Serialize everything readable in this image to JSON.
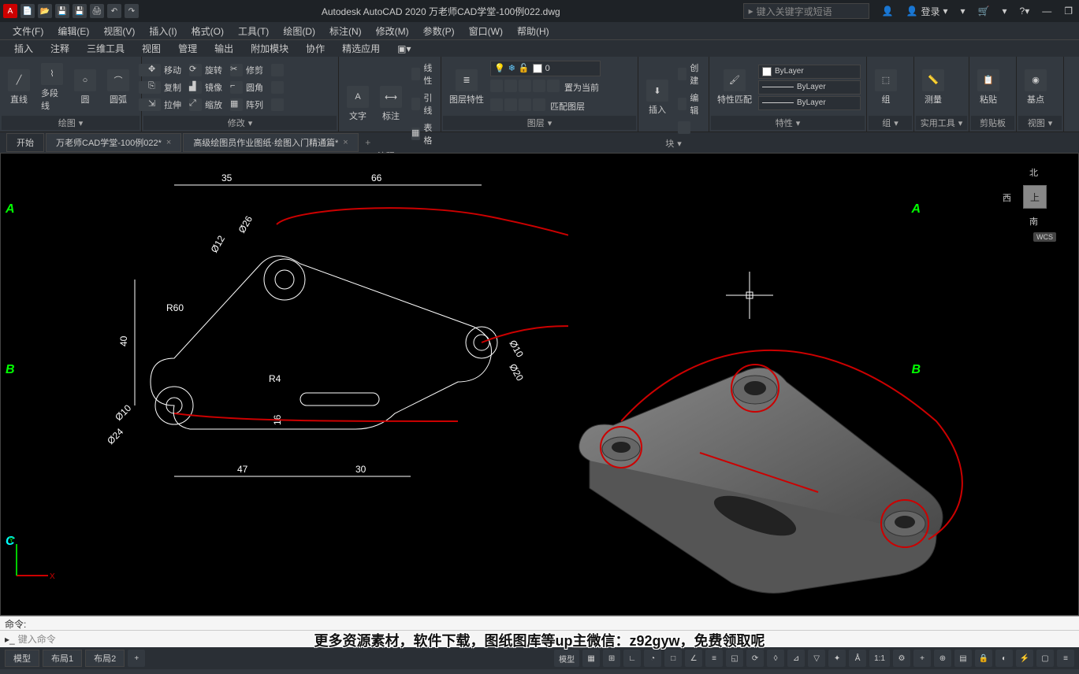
{
  "app": {
    "title": "Autodesk AutoCAD 2020   万老师CAD学堂-100例022.dwg",
    "search_placeholder": "键入关键字或短语",
    "login": "登录"
  },
  "menubar": [
    "文件(F)",
    "编辑(E)",
    "视图(V)",
    "插入(I)",
    "格式(O)",
    "工具(T)",
    "绘图(D)",
    "标注(N)",
    "修改(M)",
    "参数(P)",
    "窗口(W)",
    "帮助(H)"
  ],
  "ribbon_tabs": [
    "插入",
    "注释",
    "三维工具",
    "视图",
    "管理",
    "输出",
    "附加模块",
    "协作",
    "精选应用"
  ],
  "ribbon": {
    "draw": {
      "title": "绘图",
      "line": "直线",
      "polyline": "多段线",
      "circle": "圆",
      "arc": "圆弧"
    },
    "modify": {
      "title": "修改",
      "items": [
        "移动",
        "旋转",
        "修剪",
        "复制",
        "镜像",
        "圆角",
        "拉伸",
        "缩放",
        "阵列"
      ]
    },
    "annot": {
      "title": "注释",
      "text": "文字",
      "dim": "标注",
      "linear": "线性",
      "leader": "引线",
      "table": "表格"
    },
    "layer": {
      "title": "图层",
      "props": "图层特性",
      "current": "0",
      "set_current": "置为当前",
      "match": "匹配图层"
    },
    "block": {
      "title": "块",
      "insert": "插入",
      "create": "创建",
      "edit": "编辑"
    },
    "props": {
      "title": "特性",
      "match": "特性匹配",
      "bylayer": "ByLayer"
    },
    "group": {
      "title": "组",
      "label": "组"
    },
    "util": {
      "title": "实用工具",
      "measure": "测量"
    },
    "clip": {
      "title": "剪贴板",
      "paste": "粘贴"
    },
    "view": {
      "title": "视图",
      "base": "基点"
    }
  },
  "file_tabs": {
    "start": "开始",
    "tabs": [
      "万老师CAD学堂-100例022*",
      "高级绘图员作业图纸·绘图入门精通篇*"
    ]
  },
  "drawing": {
    "dims": {
      "d35": "35",
      "d66": "66",
      "d40": "40",
      "d47": "47",
      "d30": "30",
      "d16": "16",
      "r60": "R60",
      "r4": "R4",
      "dia26": "Ø26",
      "dia12": "Ø12",
      "dia10a": "Ø10",
      "dia20": "Ø20",
      "dia10b": "Ø10",
      "dia24": "Ø24"
    },
    "labels": {
      "A": "A",
      "B": "B",
      "C": "C"
    },
    "nav": {
      "north": "北",
      "west": "西",
      "top": "上",
      "south": "南",
      "wcs": "WCS"
    }
  },
  "cmd": {
    "history": "命令:",
    "prompt": "键入命令"
  },
  "status": {
    "model": "模型",
    "layout1": "布局1",
    "layout2": "布局2",
    "modeltab": "模型",
    "scale": "1:1"
  },
  "overlay": "更多资源素材，软件下载，图纸图库等up主微信：z92gyw，免费领取呢"
}
